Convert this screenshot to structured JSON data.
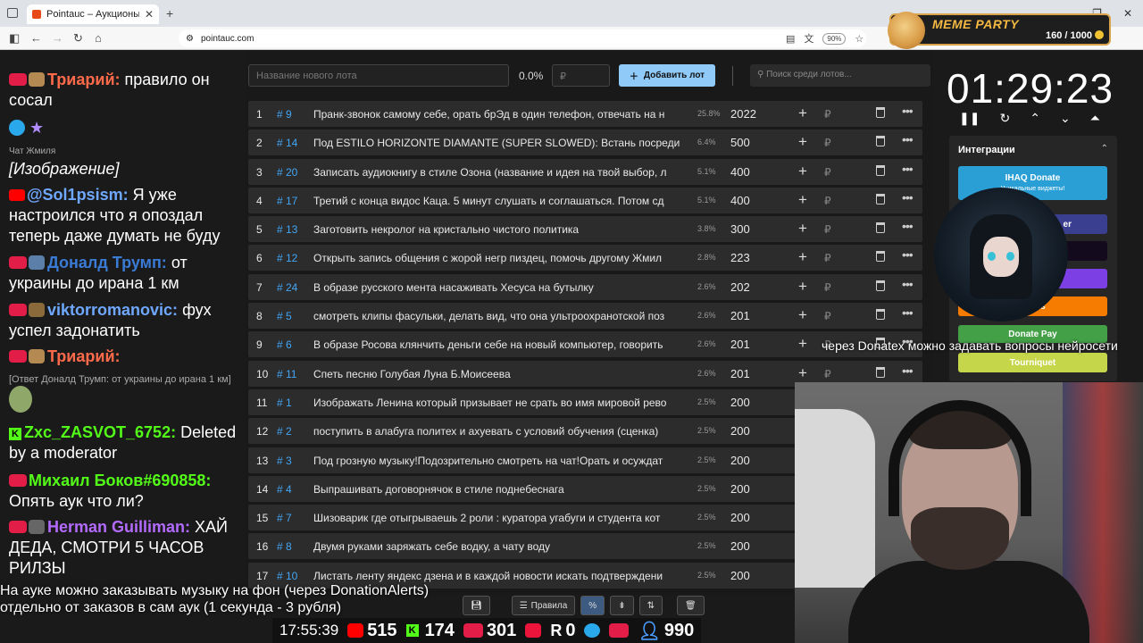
{
  "browser": {
    "tab_title": "Pointauc – Аукционы, лотереи",
    "url": "pointauc.com",
    "zoom": "90%"
  },
  "meme_party": {
    "title": "MEME PARTY",
    "counter": "160 / 1000"
  },
  "chat": [
    {
      "user": "Триарий:",
      "text": "правило он сосал",
      "user_color": "#ff6b4a"
    },
    {
      "label": "Чат Жмиля"
    },
    {
      "text": "[Изображение]"
    },
    {
      "user": "@Sol1psism:",
      "text": "Я уже настроился что я опоздал теперь даже думать не буду",
      "user_color": "#6ea8ff"
    },
    {
      "user": "Доналд Трумп:",
      "text": "от украины до ирана 1 км",
      "user_color": "#3a7bd5"
    },
    {
      "user": "viktorromanovic:",
      "text": "фух успел задонатить",
      "user_color": "#6ea8ff"
    },
    {
      "user": "Триарий:",
      "text": "",
      "user_color": "#ff6b4a"
    },
    {
      "reply": "[Ответ Доналд Трумп: от украины до ирана 1 км]"
    },
    {
      "user": "Zxc_ZASVOT_6752:",
      "text": "Deleted by a moderator",
      "user_color": "#53fc18"
    },
    {
      "user": "Михаил Боков#690858:",
      "text": "Опять аук что ли?",
      "user_color": "#53fc18"
    },
    {
      "user": "Herman Guilliman:",
      "text": "ХАЙ ДЕДА, СМОТРИ 5 ЧАСОВ РИЛЗЫ",
      "user_color": "#b36bff"
    }
  ],
  "panel": {
    "lot_placeholder": "Название нового лота",
    "percent": "0.0%",
    "rub_placeholder": "₽",
    "add_button": "Добавить лот",
    "search_placeholder": "Поиск среди лотов..."
  },
  "lots": [
    {
      "n": "1",
      "id": "# 9",
      "title": "Пранк-звонок самому себе, орать брЭд в один телефон, отвечать на н",
      "pct": "25.8%",
      "amount": "2022"
    },
    {
      "n": "2",
      "id": "# 14",
      "title": "Под ESTILO HORIZONTE DIAMANTE (SUPER SLOWED): Встань посреди",
      "pct": "6.4%",
      "amount": "500"
    },
    {
      "n": "3",
      "id": "# 20",
      "title": "Записать аудиокнигу в стиле Озона (название и идея на твой выбор, л",
      "pct": "5.1%",
      "amount": "400"
    },
    {
      "n": "4",
      "id": "# 17",
      "title": "Третий с конца видос Каца. 5 минут слушать и соглашаться. Потом сд",
      "pct": "5.1%",
      "amount": "400"
    },
    {
      "n": "5",
      "id": "# 13",
      "title": "Заготовить некролог на кристально чистого политика",
      "pct": "3.8%",
      "amount": "300"
    },
    {
      "n": "6",
      "id": "# 12",
      "title": "Открыть запись общения с жорой негр пиздец, помочь другому Жмил",
      "pct": "2.8%",
      "amount": "223"
    },
    {
      "n": "7",
      "id": "# 24",
      "title": "В образе русского мента насаживать Хесуса на бутылку",
      "pct": "2.6%",
      "amount": "202"
    },
    {
      "n": "8",
      "id": "# 5",
      "title": "смотреть клипы фасульки, делать вид, что она ультроохранотской поз",
      "pct": "2.6%",
      "amount": "201"
    },
    {
      "n": "9",
      "id": "# 6",
      "title": "В образе Росова клянчить деньги себе на новый компьютер, говорить",
      "pct": "2.6%",
      "amount": "201"
    },
    {
      "n": "10",
      "id": "# 11",
      "title": "Спеть песню Голубая Луна Б.Моисеева",
      "pct": "2.6%",
      "amount": "201"
    },
    {
      "n": "11",
      "id": "# 1",
      "title": "Изображать Ленина который призывает не срать во имя мировой рево",
      "pct": "2.5%",
      "amount": "200"
    },
    {
      "n": "12",
      "id": "# 2",
      "title": "поступить в алабуга политех и ахуевать с условий обучения (сценка)",
      "pct": "2.5%",
      "amount": "200"
    },
    {
      "n": "13",
      "id": "# 3",
      "title": "Под грозную музыку!Подозрительно смотреть на чат!Орать и осуждат",
      "pct": "2.5%",
      "amount": "200"
    },
    {
      "n": "14",
      "id": "# 4",
      "title": "Выпрашивать договорнячок в стиле поднебеснага",
      "pct": "2.5%",
      "amount": "200"
    },
    {
      "n": "15",
      "id": "# 7",
      "title": "Шизоварик где отыгрываешь 2 роли : куратора угабуги и студента кот",
      "pct": "2.5%",
      "amount": "200"
    },
    {
      "n": "16",
      "id": "# 8",
      "title": "Двумя руками заряжать себе водку, а чату воду",
      "pct": "2.5%",
      "amount": "200"
    },
    {
      "n": "17",
      "id": "# 10",
      "title": "Листать ленту яндекс дзена и в каждой новости искать подтверждени",
      "pct": "2.5%",
      "amount": "200"
    }
  ],
  "timer": "01:29:23",
  "integrations": {
    "title": "Интеграции",
    "buttons": [
      "IHAQ Donate",
      "er",
      "",
      "",
      "Alerts",
      "Donate Pay",
      "Tourniquet"
    ],
    "ihaq_sub": "Уникальные виджеты!"
  },
  "donatex_note": "через Donatex можно задавать вопросы нейросети",
  "toolbar": {
    "rules": "Правила"
  },
  "subtitle": [
    "На ауке можно заказывать музыку на фон (через DonationAlerts)",
    "отдельно от заказов в сам аук (1 секунда - 3 рубля)"
  ],
  "stats": {
    "clock": "17:55:39",
    "youtube": "515",
    "kick": "174",
    "live": "301",
    "rutube": "0",
    "telegram": "",
    "viewers": "990"
  }
}
